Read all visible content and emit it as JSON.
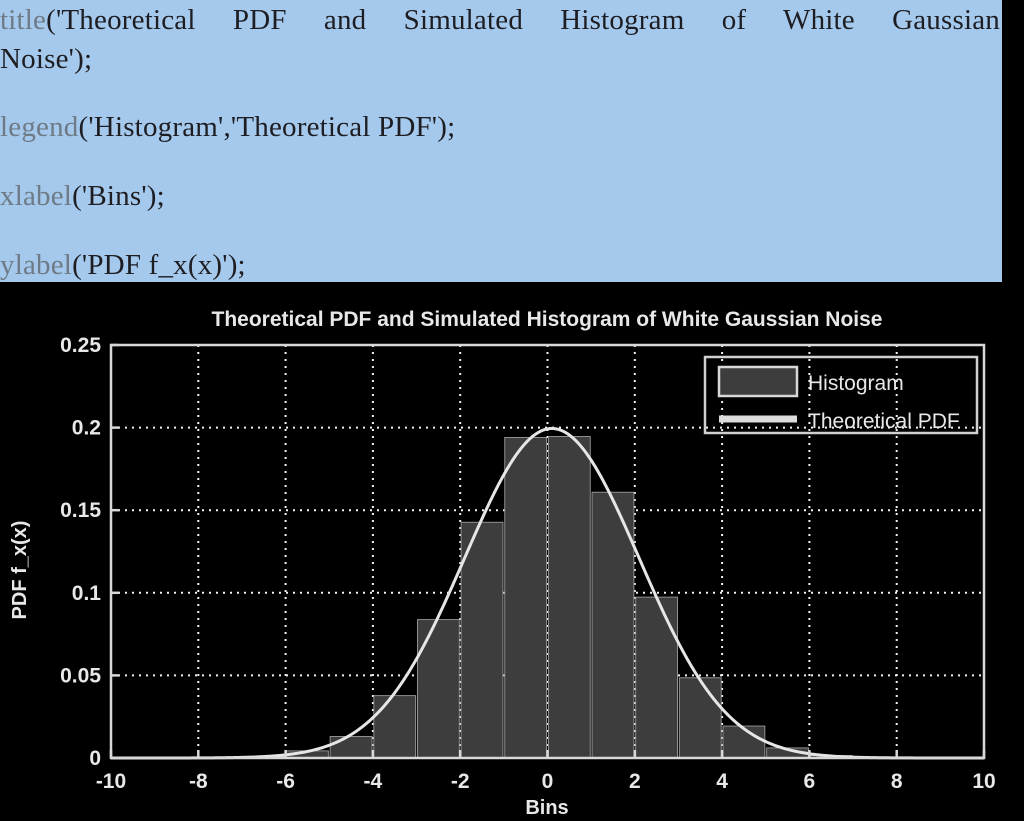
{
  "code_panel": {
    "background_color": "#a5c9ec",
    "lines": [
      {
        "id": "title_line_1",
        "text": "title('Theoretical PDF and Simulated Histogram of White Gaussian"
      },
      {
        "id": "title_line_2",
        "text": "Noise');"
      },
      {
        "id": "legend_line",
        "text": "legend('Histogram','Theoretical PDF');"
      },
      {
        "id": "xlabel_line",
        "text": "xlabel('Bins');"
      },
      {
        "id": "ylabel_line",
        "text": "ylabel('PDF f_x(x)');"
      }
    ],
    "tokens": {
      "title_fn": "title",
      "legend_fn": "legend",
      "xlabel_fn": "xlabel",
      "ylabel_fn": "ylabel",
      "title_arg_a": "('Theoretical",
      "title_arg_b": "PDF",
      "title_arg_c": "and",
      "title_arg_d": "Simulated",
      "title_arg_e": "Histogram",
      "title_arg_f": "of",
      "title_arg_g": "White",
      "title_arg_h": "Gaussian",
      "title_arg_tail": "Noise');",
      "legend_args": "('Histogram','Theoretical PDF');",
      "xlabel_args": "('Bins');",
      "ylabel_args": "('PDF f_x(x)');"
    }
  },
  "chart_data": {
    "type": "bar",
    "title": "Theoretical PDF and Simulated Histogram of White Gaussian Noise",
    "xlabel": "Bins",
    "ylabel": "PDF f_x(x)",
    "xlim": [
      -10,
      10
    ],
    "ylim": [
      0,
      0.25
    ],
    "xticks": [
      -10,
      -8,
      -6,
      -4,
      -2,
      0,
      2,
      4,
      6,
      8,
      10
    ],
    "xticklabels": [
      "-10",
      "-8",
      "-6",
      "-4",
      "-2",
      "0",
      "2",
      "4",
      "6",
      "8",
      "10"
    ],
    "yticks": [
      0,
      0.05,
      0.1,
      0.15,
      0.2,
      0.25
    ],
    "yticklabels": [
      "0",
      "0.05",
      "0.1",
      "0.15",
      "0.2",
      "0.25"
    ],
    "grid": true,
    "grid_style": "dotted",
    "grid_color": "#ffffff",
    "background": "#000000",
    "legend": {
      "position": "top-right",
      "entries": [
        {
          "label": "Histogram",
          "marker": "filled-rect",
          "color": "#3d3d3d",
          "edge": "#d8d8d8"
        },
        {
          "label": "Theoretical PDF",
          "marker": "line",
          "color": "#dcdcdc"
        }
      ]
    },
    "series": [
      {
        "name": "Histogram",
        "type": "bar",
        "bin_width": 0.125,
        "distribution": "normal",
        "mean": 0.15,
        "sigma": 2.0,
        "peak_value": 0.2,
        "bar_color": "#3d3d3d",
        "bar_edge_color": "#9a9a9a",
        "values_note": "Simulated white Gaussian noise histogram normalized to a PDF; peak ~0.2 near x=0."
      },
      {
        "name": "Theoretical PDF",
        "type": "line",
        "distribution": "normal",
        "mean": 0.1,
        "sigma": 2.0,
        "peak_value": 0.2,
        "line_color": "#e6e6e6",
        "line_width": 3
      }
    ]
  }
}
